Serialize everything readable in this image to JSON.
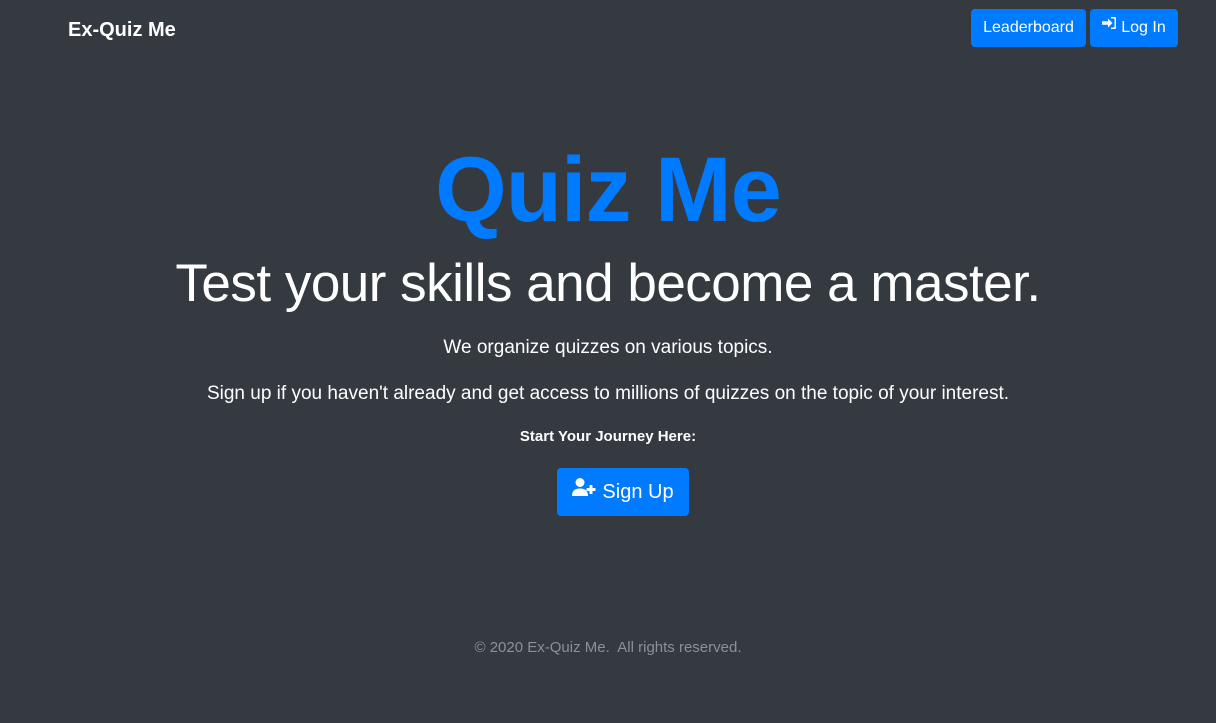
{
  "navbar": {
    "brand": "Ex-Quiz Me",
    "leaderboard_label": "Leaderboard",
    "login_label": "Log In",
    "login_icon": "sign-in-icon"
  },
  "hero": {
    "title": "Quiz Me",
    "subtitle": "Test your skills and become a master.",
    "paragraph_1": "We organize quizzes on various topics.",
    "paragraph_2": "Sign up if you haven't already and get access to millions of quizzes on the topic of your interest.",
    "journey_label": "Start Your Journey Here:",
    "signup_label": "Sign Up",
    "signup_icon": "user-plus-icon"
  },
  "footer": {
    "text": "© 2020 Ex-Quiz Me.  All rights reserved."
  },
  "colors": {
    "background": "#343a40",
    "accent": "#007bff",
    "text": "#ffffff",
    "muted": "#8a9199"
  }
}
